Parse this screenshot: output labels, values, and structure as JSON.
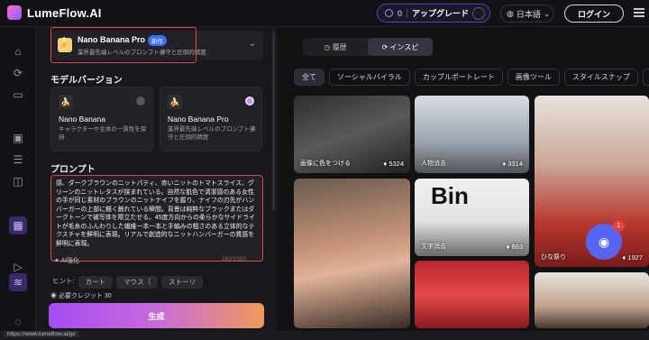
{
  "header": {
    "app_name": "LumeFlow.AI",
    "credits": "0",
    "upgrade_label": "アップグレード",
    "language": "日本語",
    "login_label": "ログイン"
  },
  "rail": {
    "icons": [
      "home-icon",
      "refresh-icon",
      "folder-icon",
      "image-edit-icon",
      "image-list-icon",
      "layers-icon",
      "image-ai-icon",
      "video-icon",
      "database-icon",
      "chat-icon"
    ]
  },
  "model_select": {
    "title": "Nano Banana Pro",
    "badge": "新作",
    "subtitle": "業界最先端レベルのプロンプト遵守と圧倒的精度"
  },
  "model_version": {
    "heading": "モデルバージョン",
    "options": [
      {
        "name": "Nano Banana",
        "desc": "キャラクターや主体の一貫性を保持",
        "selected": false
      },
      {
        "name": "Nano Banana Pro",
        "desc": "業界最先端レベルのプロンプト遵守と圧倒的精度",
        "selected": true
      }
    ]
  },
  "prompt": {
    "heading": "プロンプト",
    "text": "感、ダークブラウンのニットパティ、赤いニットのトマトスライス、グリーンのニットレタスが挟まれている。自然な肌色で清潔感のある女性の手が同じ素材のブラウンのニットナイフを握り、ナイフの刃先がハンバーガーの上部に軽く触れている瞬間。背景は純粋なブラックまたはダークトーンで被写体を際立たせる。45度方向からの柔らかなサイドライトが毛糸のふんわりした繊維一本一本と手編みの粗さのある立体的なテクスチャを鮮明に表現。リアルで創造的なニットハンバーガーの質感を鮮明に表現。",
    "enhance_label": "AI強化",
    "counter": "283/1500",
    "hint_label": "ヒント:",
    "hints": [
      "カート",
      "マウス（",
      "ストーリ"
    ]
  },
  "credit_required": "必要クレジット 30",
  "generate_label": "生成",
  "gallery": {
    "tabs": [
      "履歴",
      "インスピ"
    ],
    "active_tab": "インスピ",
    "chips": [
      "全て",
      "ソーシャルバイラル",
      "カップルポートレート",
      "画像ツール",
      "スタイルスナップ",
      "ラ"
    ],
    "cards": [
      {
        "label": "画像に色をつける",
        "likes": "5324"
      },
      {
        "label": "人物消去",
        "likes": "3314"
      },
      {
        "label": "",
        "likes": ""
      },
      {
        "label": "",
        "likes": ""
      },
      {
        "label": "文字消去",
        "likes": "883"
      },
      {
        "label": "ひな祭り",
        "likes": "1927"
      },
      {
        "label": "",
        "likes": ""
      },
      {
        "label": "",
        "likes": ""
      }
    ],
    "overlay_text": "Bin"
  },
  "discord_badge": "1",
  "status_url": "https://www.lumeflow.ai/jp/"
}
